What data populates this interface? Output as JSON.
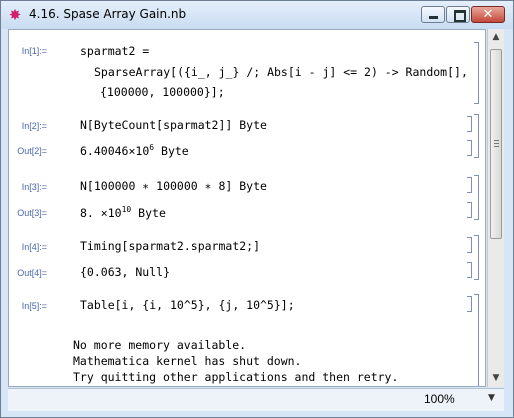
{
  "window": {
    "title": "4.16. Spase Array Gain.nb",
    "app_icon": "mathematica-star-icon"
  },
  "cells": [
    {
      "id": "in1",
      "label": "In[1]:=",
      "lines": [
        "sparmat2 =",
        "SparseArray[({i_, j_} /; Abs[i - j] <= 2) -> Random[],",
        "{100000, 100000}];"
      ]
    },
    {
      "id": "in2",
      "label": "In[2]:=",
      "text": "N[ByteCount[sparmat2]] Byte"
    },
    {
      "id": "out2",
      "label": "Out[2]=",
      "mantissa": "6.40046",
      "times": "×",
      "base": "10",
      "exponent": "6",
      "unit": "Byte"
    },
    {
      "id": "in3",
      "label": "In[3]:=",
      "text": "N[100000 ∗ 100000 ∗ 8] Byte"
    },
    {
      "id": "out3",
      "label": "Out[3]=",
      "mantissa": "8.",
      "times": "×",
      "base": "10",
      "exponent": "10",
      "unit": "Byte"
    },
    {
      "id": "in4",
      "label": "In[4]:=",
      "text": "Timing[sparmat2.sparmat2;]"
    },
    {
      "id": "out4",
      "label": "Out[4]=",
      "text": "{0.063, Null}"
    },
    {
      "id": "in5",
      "label": "In[5]:=",
      "text": "Table[i, {i, 10^5}, {j, 10^5}];"
    }
  ],
  "messages": [
    "No more memory available.",
    "Mathematica kernel has shut down.",
    "Try quitting other applications and then retry."
  ],
  "status": {
    "zoom": "100%"
  }
}
